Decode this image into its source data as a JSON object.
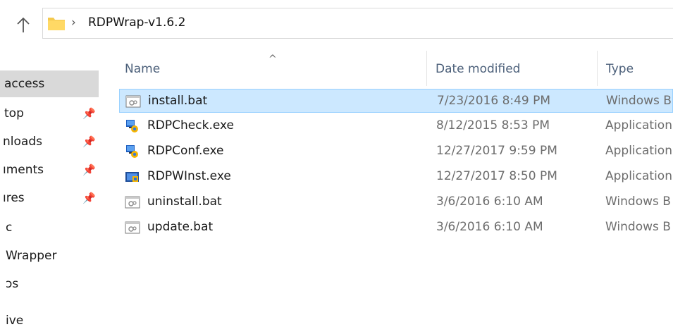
{
  "address_bar": {
    "path": "RDPWrap-v1.6.2"
  },
  "nav_pane": {
    "items": [
      {
        "label": "access",
        "pinned": false,
        "selected": true
      },
      {
        "label": "top",
        "pinned": true,
        "selected": false
      },
      {
        "label": "nloads",
        "pinned": true,
        "selected": false
      },
      {
        "label": "ıments",
        "pinned": true,
        "selected": false
      },
      {
        "label": "ıres",
        "pinned": true,
        "selected": false
      },
      {
        "label": "c",
        "pinned": false,
        "selected": false
      },
      {
        "label": "Wrapper",
        "pinned": false,
        "selected": false
      },
      {
        "label": "ɔs",
        "pinned": false,
        "selected": false
      },
      {
        "label": "ive",
        "pinned": false,
        "selected": false
      }
    ]
  },
  "columns": {
    "name": "Name",
    "date_modified": "Date modified",
    "type": "Type"
  },
  "files": [
    {
      "name": "install.bat",
      "date": "7/23/2016 8:49 PM",
      "type": "Windows B",
      "icon": "batch-file-icon",
      "selected": true
    },
    {
      "name": "RDPCheck.exe",
      "date": "8/12/2015 8:53 PM",
      "type": "Application",
      "icon": "rdp-exe-icon",
      "selected": false
    },
    {
      "name": "RDPConf.exe",
      "date": "12/27/2017 9:59 PM",
      "type": "Application",
      "icon": "rdp-exe-icon",
      "selected": false
    },
    {
      "name": "RDPWInst.exe",
      "date": "12/27/2017 8:50 PM",
      "type": "Application",
      "icon": "installer-exe-icon",
      "selected": false
    },
    {
      "name": "uninstall.bat",
      "date": "3/6/2016 6:10 AM",
      "type": "Windows B",
      "icon": "batch-file-icon",
      "selected": false
    },
    {
      "name": "update.bat",
      "date": "3/6/2016 6:10 AM",
      "type": "Windows B",
      "icon": "batch-file-icon",
      "selected": false
    }
  ],
  "colors": {
    "selection_bg": "#cce8ff",
    "selection_border": "#99d1ff",
    "header_text": "#4c607a",
    "nav_selected_bg": "#d9d9d9"
  }
}
